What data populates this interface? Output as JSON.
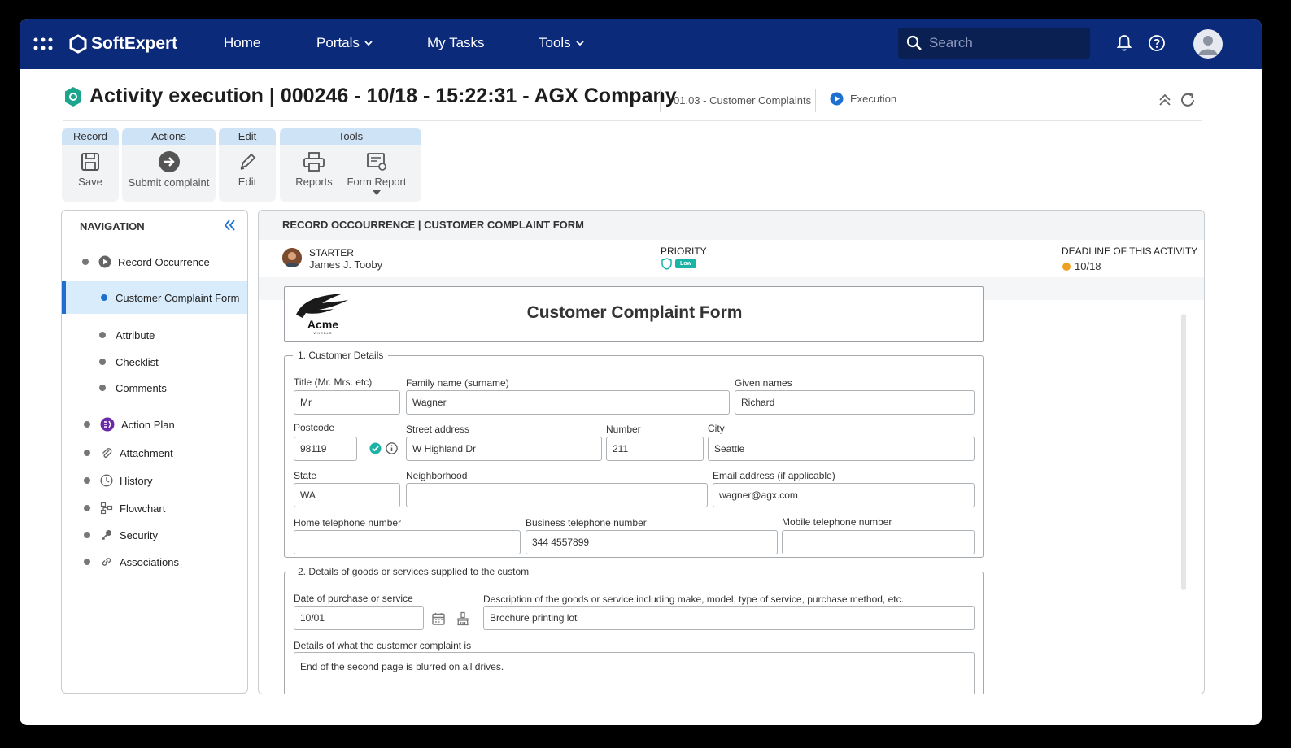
{
  "topbar": {
    "brand": "SoftExpert",
    "nav": {
      "home": "Home",
      "portals": "Portals",
      "my_tasks": "My Tasks",
      "tools": "Tools"
    },
    "search_placeholder": "Search"
  },
  "header": {
    "title": "Activity execution |  000246 - 10/18 - 15:22:31 - AGX Company",
    "process": "01.03 - Customer Complaints",
    "status": "Execution"
  },
  "toolbar": {
    "record": {
      "group": "Record",
      "save": "Save"
    },
    "actions": {
      "group": "Actions",
      "submit": "Submit complaint"
    },
    "edit": {
      "group": "Edit",
      "edit": "Edit"
    },
    "tools": {
      "group": "Tools",
      "reports": "Reports",
      "form_report": "Form Report"
    }
  },
  "navigation": {
    "title": "NAVIGATION",
    "items": [
      {
        "label": "Record Occurrence",
        "icon": "play-circle-icon"
      },
      {
        "label": "Customer Complaint Form",
        "active": true
      },
      {
        "label": "Attribute"
      },
      {
        "label": "Checklist"
      },
      {
        "label": "Comments"
      },
      {
        "label": "Action Plan",
        "icon": "action-plan-icon"
      },
      {
        "label": "Attachment",
        "icon": "paperclip-icon"
      },
      {
        "label": "History",
        "icon": "clock-icon"
      },
      {
        "label": "Flowchart",
        "icon": "flowchart-icon"
      },
      {
        "label": "Security",
        "icon": "key-icon"
      },
      {
        "label": "Associations",
        "icon": "link-icon"
      }
    ]
  },
  "main": {
    "panel_title": "RECORD OCCOURRENCE | CUSTOMER COMPLAINT FORM",
    "starter_label": "STARTER",
    "starter_name": "James J. Tooby",
    "priority_label": "PRIORITY",
    "priority_value": "Low",
    "deadline_label": "DEADLINE OF THIS ACTIVITY",
    "deadline_value": "10/18",
    "form_title": "Customer Complaint Form",
    "logo_text": "Acme",
    "logo_sub": "WHEELS"
  },
  "section1": {
    "legend": "1.   Customer Details",
    "title_label": "Title (Mr. Mrs. etc)",
    "title_value": "Mr",
    "family_label": "Family name (surname)",
    "family_value": "Wagner",
    "given_label": "Given names",
    "given_value": "Richard",
    "postcode_label": "Postcode",
    "postcode_value": "98119",
    "street_label": "Street address",
    "street_value": "W Highland Dr",
    "number_label": "Number",
    "number_value": "211",
    "city_label": "City",
    "city_value": "Seattle",
    "state_label": "State",
    "state_value": "WA",
    "neighborhood_label": "Neighborhood",
    "neighborhood_value": "",
    "email_label": "Email address (if applicable)",
    "email_value": "wagner@agx.com",
    "home_tel_label": "Home telephone number",
    "home_tel_value": "",
    "business_tel_label": "Business telephone number",
    "business_tel_value": "344 4557899",
    "mobile_tel_label": "Mobile telephone number",
    "mobile_tel_value": ""
  },
  "section2": {
    "legend": "2.   Details of goods or services supplied to the custom",
    "date_label": "Date of purchase or service",
    "date_value": "10/01",
    "desc_label": "Description of the goods or service including make, model, type of service, purchase method, etc.",
    "desc_value": "Brochure printing lot",
    "details_label": "Details of what the customer complaint is",
    "details_value": "End of the second page is blurred on all drives."
  },
  "colors": {
    "topbar": "#0b2a7a",
    "accent": "#1f6fd1",
    "priority_low": "#1bb3a6"
  }
}
